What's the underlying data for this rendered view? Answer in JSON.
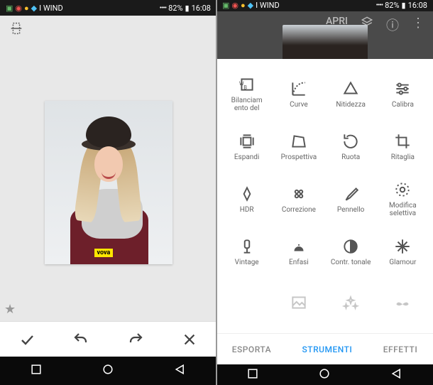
{
  "status": {
    "time": "16:08",
    "battery_pct": "82%",
    "carrier": "I WIND",
    "icons": [
      "signal",
      "wifi",
      "battery"
    ]
  },
  "editor": {
    "star_icon": "★",
    "crop_icon": "crop",
    "photo_tag": "vova",
    "bottom": {
      "confirm": "✓",
      "undo": "↶",
      "redo": "↷",
      "close": "✕"
    }
  },
  "home": {
    "open_label": "APRI",
    "header_icons": [
      "menu",
      "info",
      "layers"
    ]
  },
  "tabs": {
    "effects": "EFFETTI",
    "tools": "STRUMENTI",
    "export": "ESPORTA",
    "active": "tools"
  },
  "tools": [
    {
      "id": "calibra",
      "label": "Calibra",
      "icon": "tune"
    },
    {
      "id": "nitidezza",
      "label": "Nitidezza",
      "icon": "details"
    },
    {
      "id": "curve",
      "label": "Curve",
      "icon": "curves"
    },
    {
      "id": "bilanciamento",
      "label": "Bilanciam\nento del",
      "icon": "wb"
    },
    {
      "id": "ritaglia",
      "label": "Ritaglia",
      "icon": "crop"
    },
    {
      "id": "ruota",
      "label": "Ruota",
      "icon": "rotate"
    },
    {
      "id": "prospettiva",
      "label": "Prospettiva",
      "icon": "perspective"
    },
    {
      "id": "espandi",
      "label": "Espandi",
      "icon": "expand"
    },
    {
      "id": "modifica-selettiva",
      "label": "Modifica\nselettiva",
      "icon": "selective"
    },
    {
      "id": "pennello",
      "label": "Pennello",
      "icon": "brush"
    },
    {
      "id": "correzione",
      "label": "Correzione",
      "icon": "heal"
    },
    {
      "id": "hdr",
      "label": "HDR",
      "icon": "hdr"
    },
    {
      "id": "glamour",
      "label": "Glamour",
      "icon": "sparkle"
    },
    {
      "id": "contr-tonale",
      "label": "Contr. tonale",
      "icon": "tonal"
    },
    {
      "id": "enfasi",
      "label": "Enfasi",
      "icon": "drama"
    },
    {
      "id": "vintage",
      "label": "Vintage",
      "icon": "vintage"
    },
    {
      "id": "row5a",
      "label": "",
      "icon": "mustache",
      "dim": true
    },
    {
      "id": "row5b",
      "label": "",
      "icon": "sparks",
      "dim": true
    },
    {
      "id": "row5c",
      "label": "",
      "icon": "image",
      "dim": true
    }
  ],
  "colors": {
    "active_tab": "#2196f3"
  }
}
